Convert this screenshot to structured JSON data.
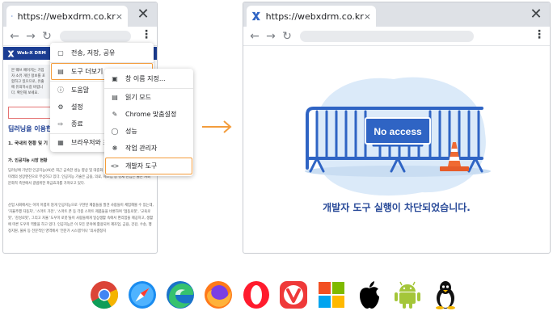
{
  "left_window": {
    "tab_title": "https://webxdrm.co.kr",
    "tab_close": "×",
    "window_close": "✕",
    "page": {
      "logo": "Web-X DRM",
      "notice_text": "본 웨브 페이지는 가입자 소유 개인 정보를 포함하고 있으므로, 유출에 유의하시길 바랍니다. 확인해 보세요.",
      "notice_button": "대리점",
      "article_title": "딥러닝을 이용한",
      "heading_1": "1. 국내외 현황 및 기",
      "heading_2": "가. 인공지능 시장 현황",
      "para_1": "딥러닝에 기반한 인공지능(AI)은 최근 급속한 성능 향상 및 대중화 가속화로 새로운 혁명을 이끌어갈 미래의 성장엔진으로 부상하고 있다. 인공지능 기술은 금융, 의료, 제조업 등 경제 산업은 물론 사회 문화적 측면에서 광범위한 파급효과를 가져오고 있다.",
      "para_2": "산업 사회에서는 이미 어렵지 않게 인공지능으로 구현된 제품들을 발견 사람들이 체험해볼 수 있는데, '자율주행 자동차', '스마트 가전', '스마트 폰 등 각종 스마트 제품들을 비롯하여 '협동로봇', '교육로봇', '감성로봇', 그리고 자율 '도우미 로봇'들이 사람들에게 일상생활 속에서 편리함을 제공하고, 생활에 따른 도우미 역할을 하고 있다. 인공지능은 이 모든 분야에 활용되어 제조업, 금융, 건강, 수송, 행정지원, 물류 등 전문적인 영역에서 '전문가 시스템'이나 '의사결정지"
    }
  },
  "main_menu": {
    "items": [
      {
        "icon": "share-icon",
        "label": "전송, 저장, 공유"
      },
      {
        "icon": "toolbox-icon",
        "label": "도구 더보기"
      },
      {
        "icon": "help-icon",
        "label": "도움말"
      },
      {
        "icon": "gear-icon",
        "label": "설정"
      },
      {
        "icon": "exit-icon",
        "label": "종료"
      },
      {
        "icon": "managed-icon",
        "label": "브라우저와 프"
      }
    ]
  },
  "sub_menu": {
    "items": [
      {
        "icon": "window-icon",
        "label": "창 이름 지정..."
      },
      {
        "icon": "reader-icon",
        "label": "읽기 모드"
      },
      {
        "icon": "pencil-icon",
        "label": "Chrome 맞춤설정"
      },
      {
        "icon": "performance-icon",
        "label": "성능"
      },
      {
        "icon": "task-manager-icon",
        "label": "작업 관리자"
      },
      {
        "icon": "code-icon",
        "label": "개발자 도구"
      }
    ]
  },
  "right_window": {
    "tab_title": "https://webxdrm.co.kr",
    "tab_close": "×",
    "window_close": "✕",
    "sign_text": "No access",
    "blocked_message": "개발자 도구 실행이 차단되었습니다."
  },
  "os_icons": [
    "chrome-icon",
    "safari-icon",
    "edge-icon",
    "firefox-icon",
    "opera-icon",
    "vivaldi-icon",
    "windows-icon",
    "apple-icon",
    "android-icon",
    "linux-icon"
  ],
  "colors": {
    "accent_orange": "#f39c3c",
    "barrier_blue": "#2f64c4",
    "message_blue": "#2a4b99",
    "site_header_navy": "#1b3d93"
  }
}
